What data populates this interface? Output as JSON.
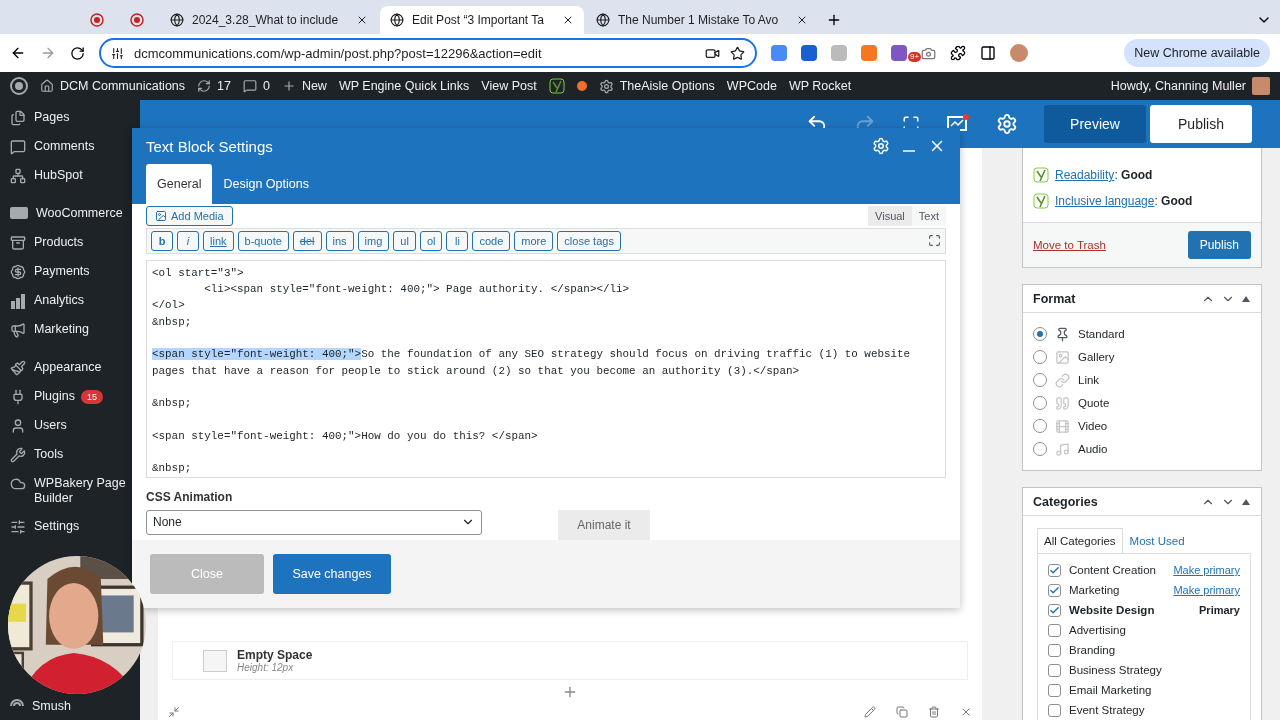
{
  "browser": {
    "tabs": [
      {
        "kind": "pinned",
        "selected": false
      },
      {
        "kind": "pinned",
        "selected": false
      },
      {
        "kind": "page",
        "title": "2024_3.28_What to include",
        "selected": false
      },
      {
        "kind": "page",
        "title": "Edit Post “3 Important Ta",
        "selected": true
      },
      {
        "kind": "page",
        "title": "The Number 1 Mistake To Avo",
        "selected": false
      }
    ],
    "url": "dcmcommunications.com/wp-admin/post.php?post=12296&action=edit",
    "extension_badge": "9+",
    "update_button": "New Chrome available"
  },
  "admin_bar": {
    "items": [
      {
        "label": "DCM Communications"
      },
      {
        "label": "17"
      },
      {
        "label": "0"
      },
      {
        "label": "New"
      },
      {
        "label": "WP Engine Quick Links"
      },
      {
        "label": "View Post"
      },
      {
        "label": "TheAisle Options"
      },
      {
        "label": "WPCode"
      },
      {
        "label": "WP Rocket"
      }
    ],
    "greeting": "Howdy, Channing Muller"
  },
  "sidebar": {
    "groups": [
      [
        {
          "label": "Pages"
        },
        {
          "label": "Comments"
        },
        {
          "label": "HubSpot"
        }
      ],
      [
        {
          "label": "WooCommerce"
        },
        {
          "label": "Products"
        },
        {
          "label": "Payments"
        },
        {
          "label": "Analytics"
        },
        {
          "label": "Marketing"
        }
      ],
      [
        {
          "label": "Appearance"
        },
        {
          "label": "Plugins",
          "badge": "15"
        },
        {
          "label": "Users"
        },
        {
          "label": "Tools"
        },
        {
          "label": "WPBakery Page Builder"
        },
        {
          "label": "Settings"
        }
      ],
      [
        {
          "label": "Smush"
        }
      ]
    ]
  },
  "builder_bar": {
    "preview": "Preview",
    "publish": "Publish"
  },
  "modal": {
    "title": "Text Block Settings",
    "tabs": [
      {
        "label": "General",
        "selected": true
      },
      {
        "label": "Design Options",
        "selected": false
      }
    ],
    "add_media": "Add Media",
    "editor_tabs": [
      {
        "label": "Visual",
        "selected": false
      },
      {
        "label": "Text",
        "selected": true
      }
    ],
    "quicktags": [
      {
        "label": "b",
        "kind": "bold"
      },
      {
        "label": "i",
        "kind": "italic"
      },
      {
        "label": "link",
        "kind": "link"
      },
      {
        "label": "b-quote",
        "kind": "plain"
      },
      {
        "label": "del",
        "kind": "strike"
      },
      {
        "label": "ins",
        "kind": "plain"
      },
      {
        "label": "img",
        "kind": "plain"
      },
      {
        "label": "ul",
        "kind": "plain"
      },
      {
        "label": "ol",
        "kind": "plain"
      },
      {
        "label": "li",
        "kind": "plain"
      },
      {
        "label": "code",
        "kind": "plain"
      },
      {
        "label": "more",
        "kind": "plain"
      },
      {
        "label": "close tags",
        "kind": "plain"
      }
    ],
    "code_lines": [
      {
        "text": "<ol start=\"3\">",
        "blank_line_before": false
      },
      {
        "text": "        <li><span style=\"font-weight: 400;\"> Page authority. </span></li>",
        "blank_line_before": false
      },
      {
        "text": "</ol>",
        "blank_line_before": false
      },
      {
        "text": "&nbsp;",
        "blank_line_before": false
      },
      {
        "highlight": "<span style=\"font-weight: 400;\">",
        "text": "So the foundation of any SEO strategy should focus on driving traffic (1) to website pages that have a reason for people to stick around (2) so that you become an authority (3).</span>",
        "blank_line_before": true
      },
      {
        "text": "&nbsp;",
        "blank_line_before": true
      },
      {
        "text": "<span style=\"font-weight: 400;\">How do you do this? </span>",
        "blank_line_before": true
      },
      {
        "text": "&nbsp;",
        "blank_line_before": true
      }
    ],
    "animation_label": "CSS Animation",
    "animation_value": "None",
    "animate_button": "Animate it",
    "close_button": "Close",
    "save_button": "Save changes"
  },
  "publish_box": {
    "checks": [
      {
        "label": "Readability",
        "rating": ": **Good**"
      },
      {
        "label": "Inclusive language",
        "rating": ": **Good**"
      }
    ],
    "trash": "Move to Trash",
    "publish": "Publish"
  },
  "format_box": {
    "title": "Format",
    "options": [
      {
        "label": "Standard",
        "selected": true
      },
      {
        "label": "Gallery",
        "selected": false
      },
      {
        "label": "Link",
        "selected": false
      },
      {
        "label": "Quote",
        "selected": false
      },
      {
        "label": "Video",
        "selected": false
      },
      {
        "label": "Audio",
        "selected": false
      }
    ]
  },
  "categories_box": {
    "title": "Categories",
    "tabs": [
      {
        "label": "All Categories",
        "selected": true
      },
      {
        "label": "Most Used",
        "selected": false
      }
    ],
    "items": [
      {
        "label": "Content Creation",
        "checked": true,
        "action": "Make primary"
      },
      {
        "label": "Marketing",
        "checked": true,
        "action": "Make primary"
      },
      {
        "label": "Website Design",
        "checked": true,
        "badge": "Primary"
      },
      {
        "label": "Advertising",
        "checked": false
      },
      {
        "label": "Branding",
        "checked": false
      },
      {
        "label": "Business Strategy",
        "checked": false
      },
      {
        "label": "Email Marketing",
        "checked": false
      },
      {
        "label": "Event Strategy",
        "checked": false
      }
    ]
  },
  "canvas": {
    "element_title": "Empty Space",
    "element_subtitle": "Height: 12px"
  }
}
